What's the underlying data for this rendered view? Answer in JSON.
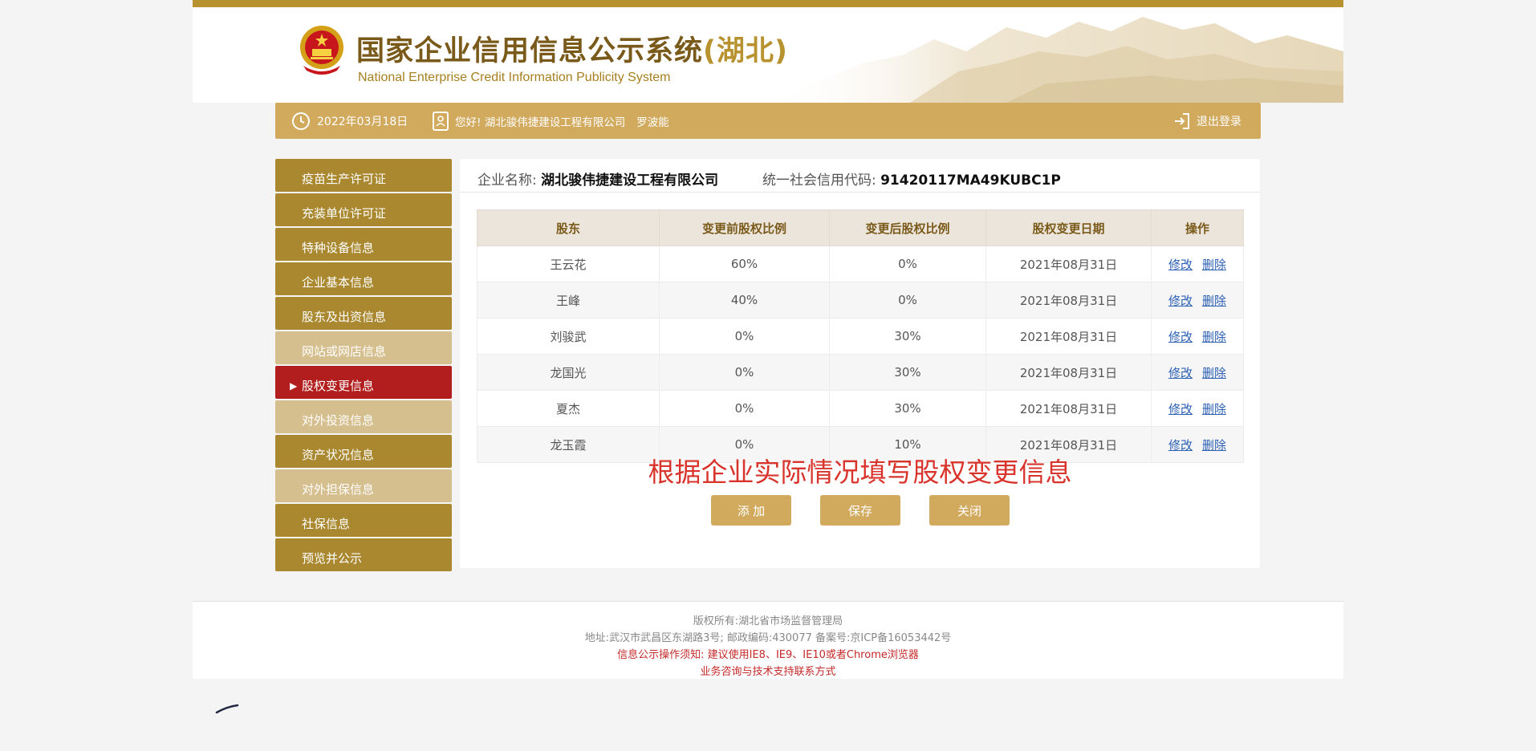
{
  "header": {
    "title_cn": "国家企业信用信息公示系统",
    "title_region": "(湖北)",
    "title_en": "National Enterprise Credit Information Publicity System"
  },
  "infobar": {
    "date": "2022年03月18日",
    "greeting": "您好!  湖北骏伟捷建设工程有限公司",
    "user": "罗波能",
    "logout": "退出登录"
  },
  "sidebar": {
    "items": [
      {
        "label": "疫苗生产许可证",
        "state": "normal"
      },
      {
        "label": "充装单位许可证",
        "state": "normal"
      },
      {
        "label": "特种设备信息",
        "state": "normal"
      },
      {
        "label": "企业基本信息",
        "state": "normal"
      },
      {
        "label": "股东及出资信息",
        "state": "normal"
      },
      {
        "label": "网站或网店信息",
        "state": "light"
      },
      {
        "label": "股权变更信息",
        "state": "active"
      },
      {
        "label": "对外投资信息",
        "state": "light"
      },
      {
        "label": "资产状况信息",
        "state": "normal"
      },
      {
        "label": "对外担保信息",
        "state": "light"
      },
      {
        "label": "社保信息",
        "state": "normal"
      },
      {
        "label": "预览并公示",
        "state": "normal"
      }
    ]
  },
  "enterprise": {
    "name_label": "企业名称:",
    "name": "湖北骏伟捷建设工程有限公司",
    "code_label": "统一社会信用代码:",
    "code": "91420117MA49KUBC1P"
  },
  "table": {
    "headers": [
      "股东",
      "变更前股权比例",
      "变更后股权比例",
      "股权变更日期",
      "操作"
    ],
    "rows": [
      [
        "王云花",
        "60%",
        "0%",
        "2021年08月31日"
      ],
      [
        "王峰",
        "40%",
        "0%",
        "2021年08月31日"
      ],
      [
        "刘骏武",
        "0%",
        "30%",
        "2021年08月31日"
      ],
      [
        "龙国光",
        "0%",
        "30%",
        "2021年08月31日"
      ],
      [
        "夏杰",
        "0%",
        "30%",
        "2021年08月31日"
      ],
      [
        "龙玉霞",
        "0%",
        "10%",
        "2021年08月31日"
      ]
    ],
    "edit_label": "修改",
    "delete_label": "删除"
  },
  "hint": "根据企业实际情况填写股权变更信息",
  "buttons": {
    "add": "添 加",
    "save": "保存",
    "close": "关闭"
  },
  "footer": {
    "copyright": "版权所有:湖北省市场监督管理局",
    "address": "地址:武汉市武昌区东湖路3号; 邮政编码:430077 备案号:京ICP备16053442号",
    "notice": "信息公示操作须知:  建议使用IE8、IE9、IE10或者Chrome浏览器",
    "support": "业务咨询与技术支持联系方式"
  },
  "colors": {
    "gold": "#d1aa5e",
    "dark_gold": "#a98830",
    "active_red": "#b21e1e",
    "hint_red": "#d9342b"
  }
}
